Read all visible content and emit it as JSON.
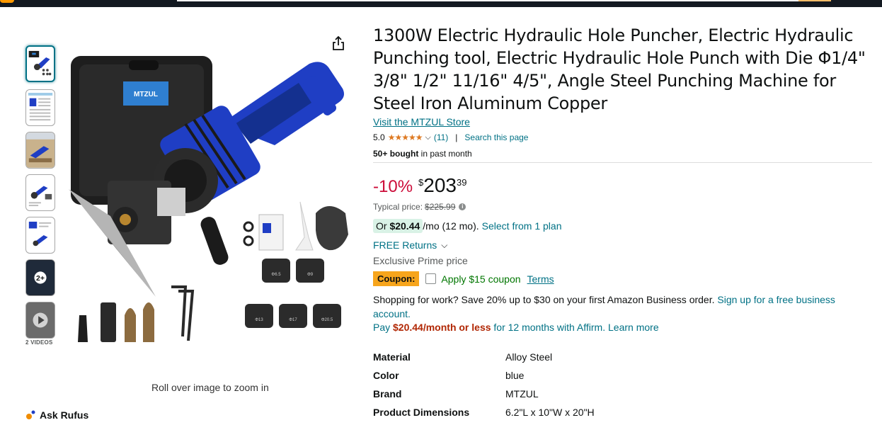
{
  "product": {
    "title": "1300W Electric Hydraulic Hole Puncher, Electric Hydraulic Punching tool, Electric Hydraulic Hole Punch with Die Φ1/4\" 3/8\" 1/2\" 11/16\" 4/5\", Angle Steel Punching Machine for Steel Iron Aluminum Copper",
    "store_link": "Visit the MTZUL Store",
    "rating_value": "5.0",
    "stars": "★★★★★",
    "rating_count": "(11)",
    "rating_separator": "|",
    "search_page": "Search this page",
    "bought_bold": "50+ bought",
    "bought_rest": " in past month"
  },
  "gallery": {
    "videos_label": "2 VIDEOS",
    "more_count": "2+",
    "zoom_hint": "Roll over image to zoom in",
    "case_brand": "MTZUL",
    "die_sizes": [
      "Φ6.5",
      "Φ9",
      "Φ13",
      "Φ17",
      "Φ20.5"
    ]
  },
  "rufus": {
    "label": "Ask Rufus"
  },
  "pricing": {
    "discount": "-10%",
    "currency": "$",
    "whole": "203",
    "fraction": "39",
    "typical_label": "Typical price:",
    "typical_price": "$225.99",
    "info": "i",
    "installment_prefix": "Or ",
    "installment_amount": "$20.44",
    "installment_suffix": "/mo (12 mo).",
    "installment_link": "Select from 1 plan",
    "free_returns": "FREE Returns",
    "prime_price": "Exclusive Prime price"
  },
  "coupon": {
    "badge": "Coupon:",
    "text": "Apply $15 coupon",
    "terms": "Terms"
  },
  "business": {
    "text": "Shopping for work? Save 20% up to $30 on your first Amazon Business order. ",
    "link": "Sign up for a free business account."
  },
  "affirm": {
    "pay": "Pay ",
    "amount": "$20.44/month or less",
    "rest": " for 12 months with Affirm. ",
    "learn_more": "Learn more"
  },
  "specs": [
    {
      "key": "Material",
      "value": "Alloy Steel"
    },
    {
      "key": "Color",
      "value": "blue"
    },
    {
      "key": "Brand",
      "value": "MTZUL"
    },
    {
      "key": "Product Dimensions",
      "value": "6.2\"L x 10\"W x 20\"H"
    }
  ],
  "colors": {
    "link": "#007185",
    "discount": "#cc0c39",
    "star": "#de7921",
    "coupon_badge": "#f7a51c",
    "coupon_text": "#007600",
    "tool_blue": "#1f3ec4"
  }
}
